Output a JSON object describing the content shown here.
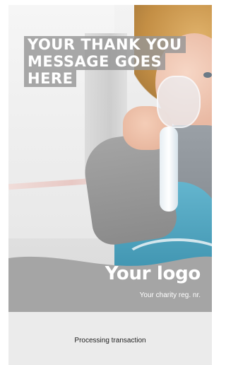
{
  "hero": {
    "headline_lines": [
      "YOUR THANK YOU",
      "MESSAGE GOES",
      "HERE"
    ]
  },
  "branding": {
    "logo_text": "Your logo",
    "reg_text": "Your charity reg. nr."
  },
  "footer": {
    "status_text": "Processing transaction"
  },
  "colors": {
    "overlay_gray": "#969696",
    "wave_gray": "#a5a5a5",
    "footer_bg": "#ebebeb",
    "text_white": "#ffffff"
  }
}
